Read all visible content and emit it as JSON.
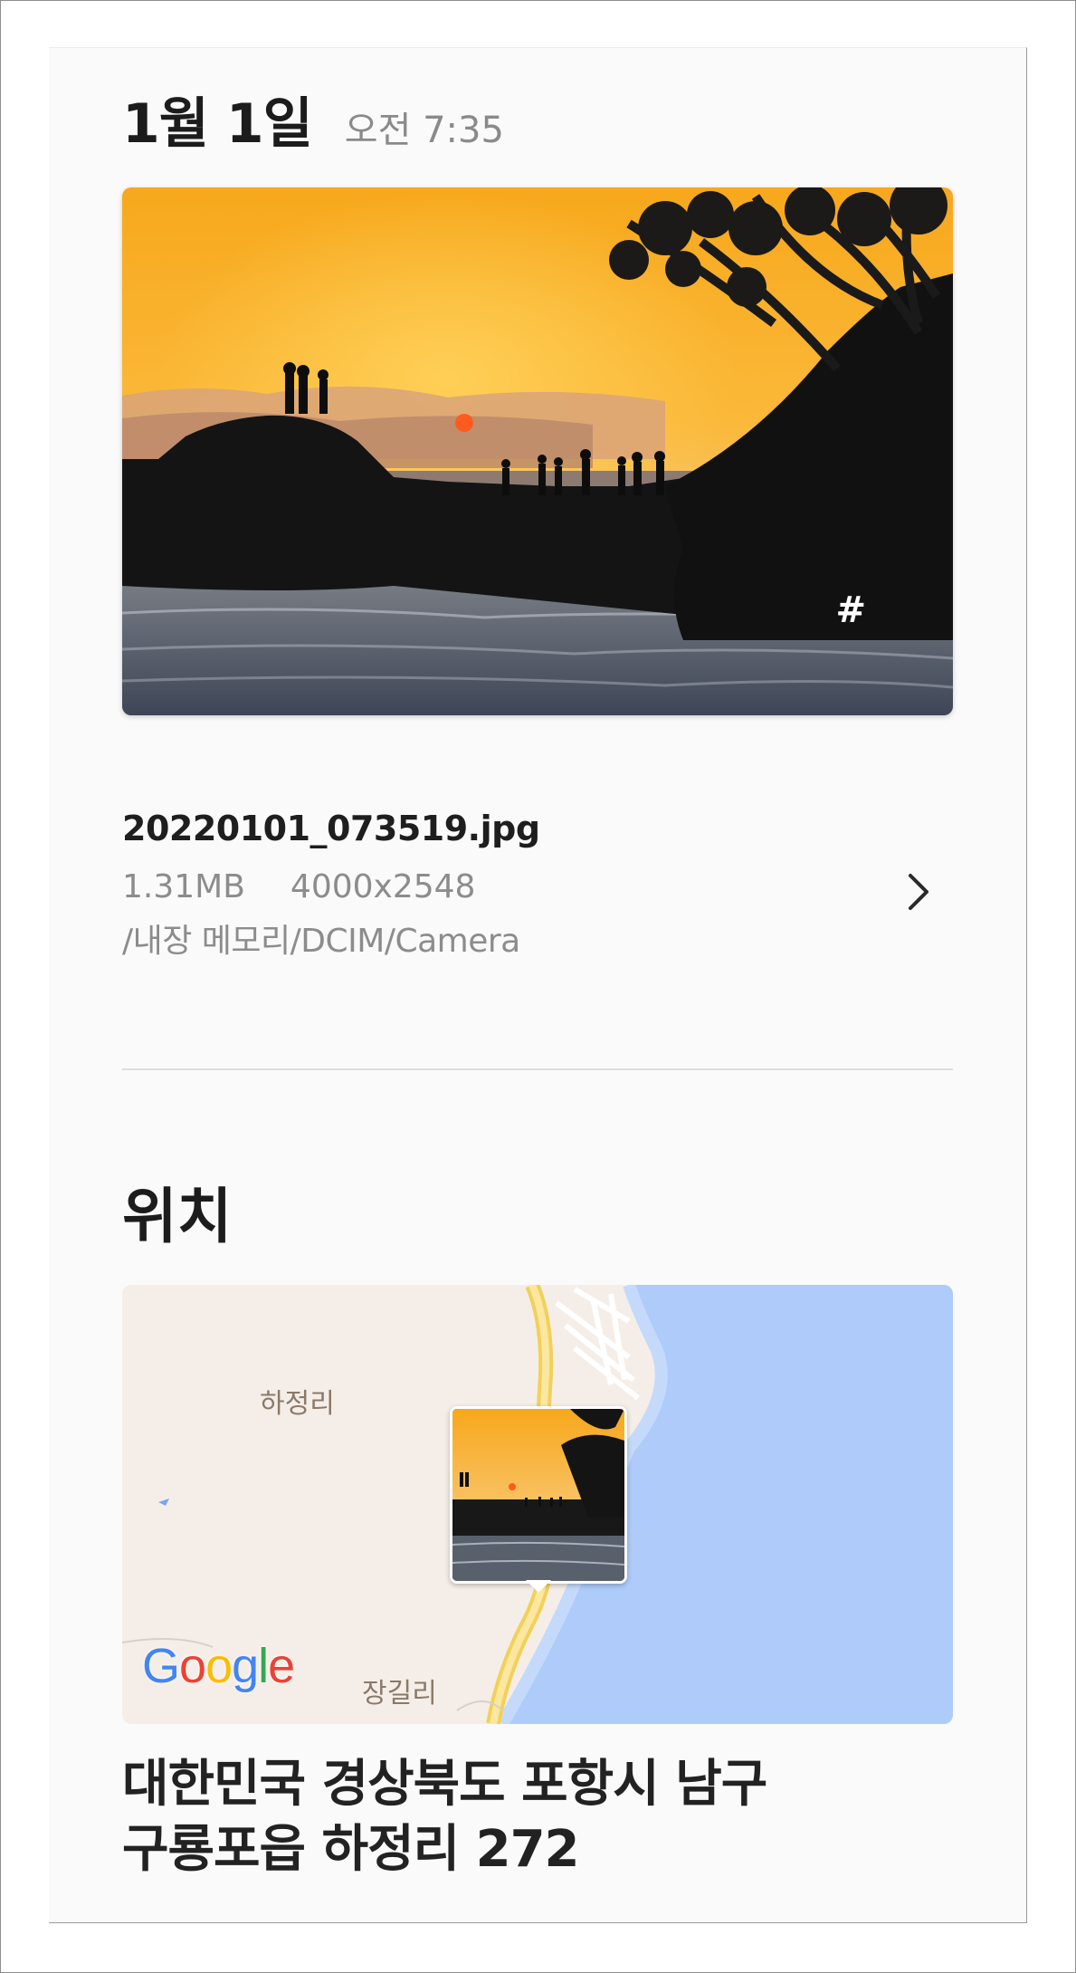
{
  "header": {
    "date": "1월 1일",
    "time": "오전 7:35"
  },
  "photo": {
    "tag_icon": "hashtag-icon",
    "tag_glyph": "#"
  },
  "file": {
    "name": "20220101_073519.jpg",
    "size": "1.31MB",
    "resolution": "4000x2548",
    "path": "/내장 메모리/DCIM/Camera",
    "chevron_icon": "chevron-right-icon"
  },
  "location": {
    "title": "위치",
    "map_labels": {
      "place_1": "하정리",
      "place_2": "장길리"
    },
    "map_provider": "Google",
    "address_line_1": "대한민국 경상북도 포항시 남구",
    "address_line_2": "구룡포읍 하정리 272"
  },
  "colors": {
    "google_blue": "#4285F4",
    "google_red": "#EA4335",
    "google_yellow": "#FBBC05",
    "google_green": "#34A853",
    "sea": "#AECBFA",
    "land": "#F5EEE8",
    "road": "#F2D15A"
  }
}
